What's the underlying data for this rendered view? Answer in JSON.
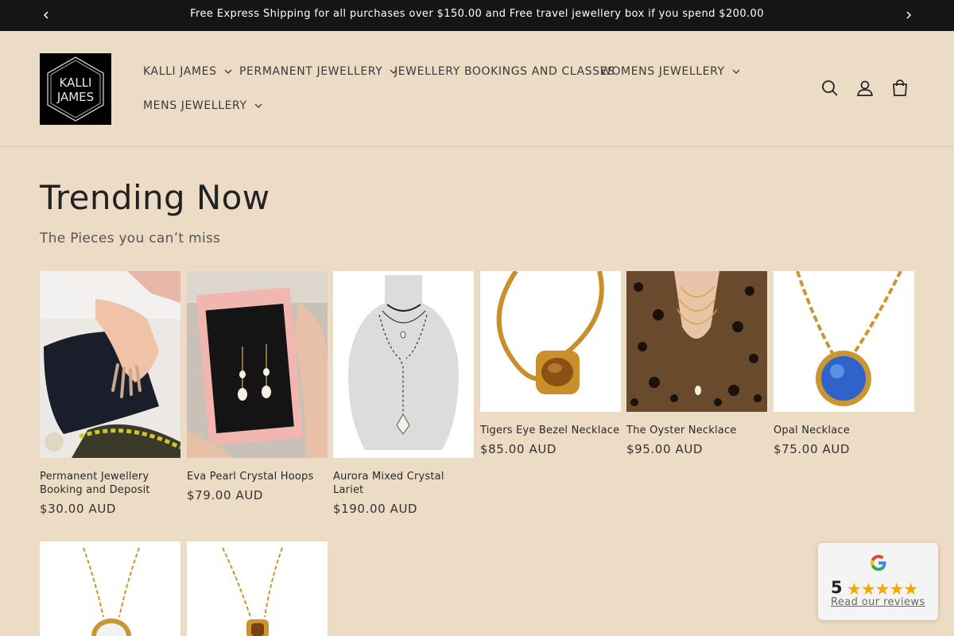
{
  "announcement": {
    "text": "Free Express Shipping for all purchases over $150.00 and Free travel jewellery box if you spend $200.00",
    "prev_icon": "chevron-left-icon",
    "next_icon": "chevron-right-icon"
  },
  "logo": {
    "line1": "KALLI",
    "line2": "JAMES"
  },
  "nav": [
    {
      "label": "KALLI JAMES",
      "has_dropdown": true
    },
    {
      "label": "PERMANENT JEWELLERY",
      "has_dropdown": true
    },
    {
      "label": "JEWELLERY BOOKINGS AND CLASSES",
      "has_dropdown": false
    },
    {
      "label": "WOMENS JEWELLERY",
      "has_dropdown": true
    },
    {
      "label": "MENS JEWELLERY",
      "has_dropdown": true
    }
  ],
  "header_icons": [
    "search-icon",
    "account-icon",
    "cart-icon"
  ],
  "section": {
    "title": "Trending Now",
    "subtitle": "The Pieces you can’t miss"
  },
  "products": [
    {
      "name": "Permanent Jewellery Booking and Deposit",
      "price": "$30.00 AUD"
    },
    {
      "name": "Eva Pearl Crystal Hoops",
      "price": "$79.00 AUD"
    },
    {
      "name": "Aurora Mixed Crystal Lariet",
      "price": "$190.00 AUD"
    },
    {
      "name": "Tigers Eye Bezel Necklace",
      "price": "$85.00 AUD"
    },
    {
      "name": "The Oyster Necklace",
      "price": "$95.00 AUD"
    },
    {
      "name": "Opal Necklace",
      "price": "$75.00 AUD"
    },
    {
      "name": "",
      "price": ""
    },
    {
      "name": "",
      "price": ""
    }
  ],
  "reviews": {
    "score": "5",
    "stars": "★★★★★",
    "link": "Read our reviews",
    "star_color": "#f5a700"
  },
  "colors": {
    "background": "#ecdbc5",
    "announcement_bar": "#151515"
  }
}
